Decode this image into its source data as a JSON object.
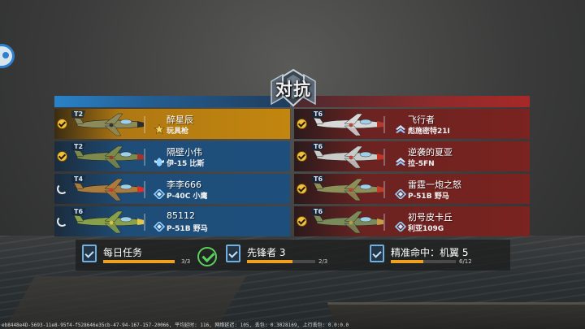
{
  "title": "对抗",
  "blue_team": [
    {
      "tier": "T2",
      "name": "醉星辰",
      "plane": "玩具枪",
      "status": "ready",
      "highlight": true,
      "rank_icon": "star-rank-icon",
      "colors": {
        "body": "#8b8a5a",
        "accent": "#2b2b2b"
      }
    },
    {
      "tier": "T2",
      "name": "隔壁小伟",
      "plane": "伊-15 比斯",
      "status": "ready",
      "highlight": false,
      "rank_icon": "wing-rank-icon",
      "colors": {
        "body": "#7c8a4c",
        "accent": "#a6322a"
      }
    },
    {
      "tier": "T4",
      "name": "李李666",
      "plane": "P-40C 小鹰",
      "status": "loading",
      "highlight": false,
      "rank_icon": "diamond-rank-icon",
      "colors": {
        "body": "#a97c3d",
        "accent": "#d9302a"
      }
    },
    {
      "tier": "T6",
      "name": "85112",
      "plane": "P-51B 野马",
      "status": "loading",
      "highlight": false,
      "rank_icon": "diamond-rank-icon",
      "colors": {
        "body": "#88a04a",
        "accent": "#e5c64a"
      }
    }
  ],
  "red_team": [
    {
      "tier": "T6",
      "name": "飞行者",
      "plane": "彪施密特21I",
      "status": "ready",
      "rank_icon": "chevron-rank-icon",
      "colors": {
        "body": "#d8d8d8",
        "accent": "#b23a2e"
      }
    },
    {
      "tier": "T6",
      "name": "逆袭的夏亚",
      "plane": "拉-5FN",
      "status": "ready",
      "rank_icon": "chevron-rank-icon",
      "colors": {
        "body": "#c9cbc8",
        "accent": "#c23226"
      }
    },
    {
      "tier": "T6",
      "name": "雷霆一炮之怒",
      "plane": "P-51B 野马",
      "status": "ready",
      "rank_icon": "diamond-rank-icon",
      "colors": {
        "body": "#8e8e58",
        "accent": "#c23a2a"
      }
    },
    {
      "tier": "T6",
      "name": "初号皮卡丘",
      "plane": "利亚109G",
      "status": "ready",
      "rank_icon": "diamond-rank-icon",
      "colors": {
        "body": "#7a8a58",
        "accent": "#c79e48"
      }
    }
  ],
  "tasks": [
    {
      "label": "每日任务",
      "progress_text": "3/3",
      "progress": 1.0
    },
    {
      "label": "先锋者 3",
      "progress_text": "2/3",
      "progress": 0.667
    },
    {
      "label": "精准命中：机翼 5",
      "progress_text": "6/12",
      "progress": 0.5
    }
  ],
  "footer": "eb8448e4D-5693-11e8-95f4-f528646e35cb-47-94-167-157-20066, 平均延时: 116, 网络延迟: 105, 丢包: 0.3028169, 上行丢包: 0.0:0.0",
  "colors": {
    "blue_team": "#1e4e7c",
    "red_team": "#7a2320",
    "highlight": "#c2860f",
    "progress": "#f0a020",
    "done": "#5cd05c"
  }
}
